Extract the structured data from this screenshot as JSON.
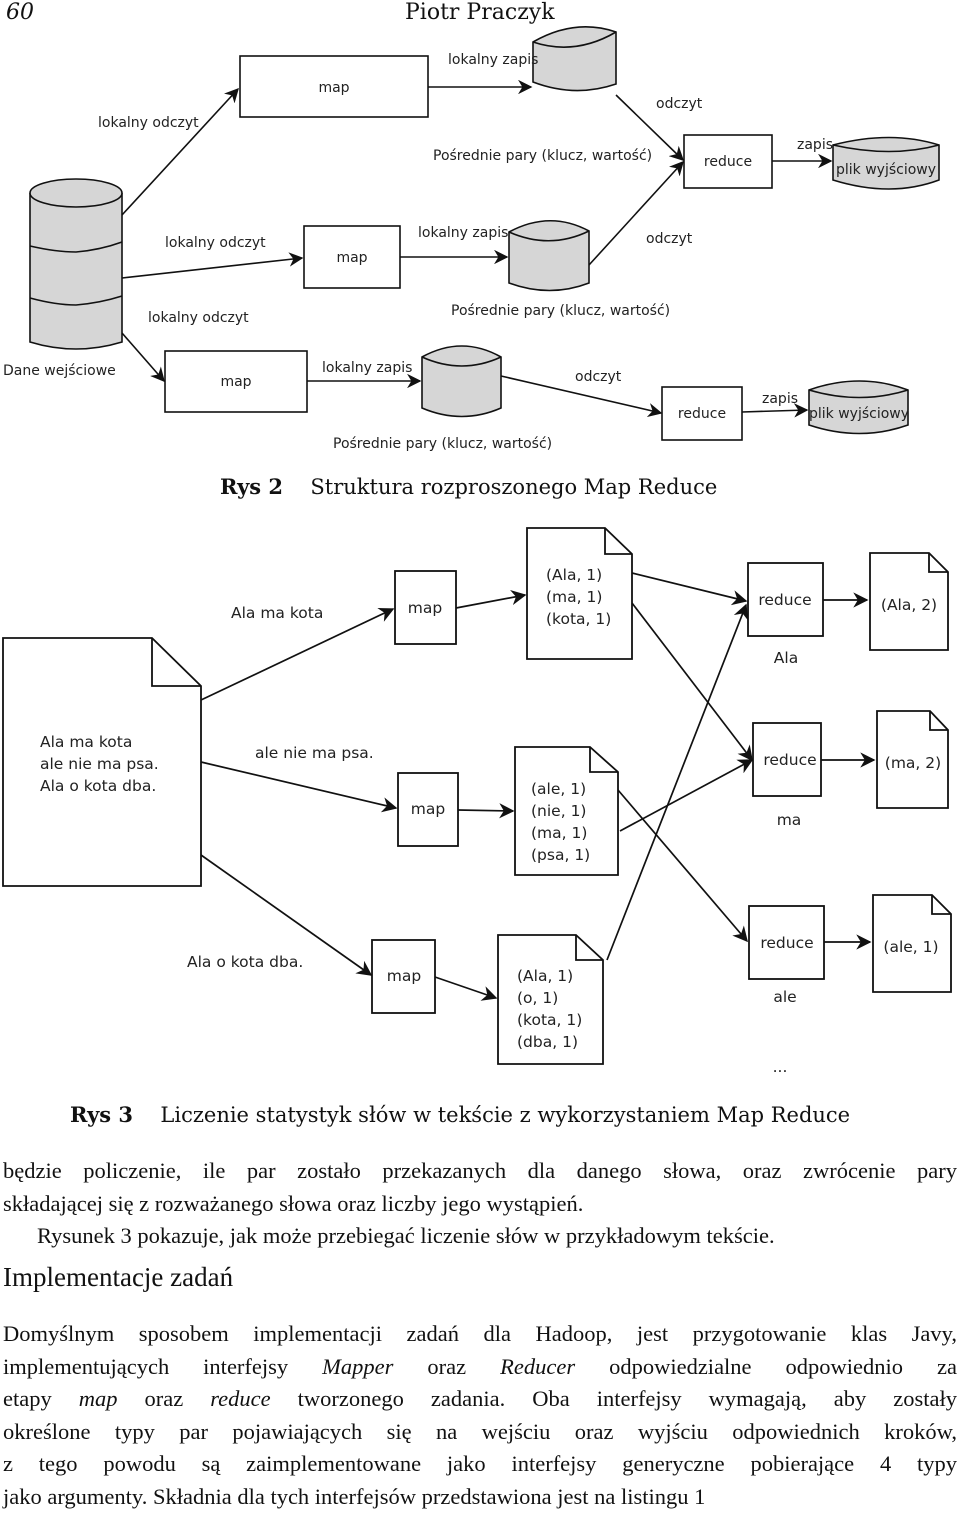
{
  "header": {
    "page_number": "60",
    "running_head": "Piotr Praczyk"
  },
  "figure2": {
    "input_label": "Dane wejściowe",
    "map_label": "map",
    "reduce_label": "reduce",
    "output_label": "plik wyjściowy",
    "local_read": "lokalny odczyt",
    "local_write": "lokalny zapis",
    "read": "odczyt",
    "write": "zapis",
    "intermediate": "Pośrednie pary (klucz, wartość)",
    "caption_num": "Rys 2",
    "caption_text": "Struktura rozproszonego Map Reduce"
  },
  "figure3": {
    "input_doc_lines": [
      "Ala ma kota",
      "ale nie ma psa.",
      "Ala o kota dba."
    ],
    "splits": [
      "Ala ma kota",
      "ale nie ma psa.",
      "Ala o kota dba."
    ],
    "map_label": "map",
    "reduce_label": "reduce",
    "intermediate_docs": [
      [
        "(Ala, 1)",
        "(ma, 1)",
        "(kota, 1)"
      ],
      [
        "(ale, 1)",
        "(nie, 1)",
        "(ma, 1)",
        "(psa, 1)"
      ],
      [
        "(Ala, 1)",
        "(o, 1)",
        "(kota, 1)",
        "(dba, 1)"
      ]
    ],
    "reducer_keys": [
      "Ala",
      "ma",
      "ale"
    ],
    "outputs": [
      "(Ala, 2)",
      "(ma, 2)",
      "(ale, 1)"
    ],
    "ellipsis": "...",
    "caption_num": "Rys 3",
    "caption_text": "Liczenie statystyk słów w tekście z wykorzystaniem Map Reduce"
  },
  "body": {
    "para1_lines": [
      "będzie policzenie, ile par zostało przekazanych dla danego słowa, oraz zwrócenie pary",
      "składającej się z rozważanego słowa oraz liczby jego wystąpień."
    ],
    "para2": "Rysunek 3 pokazuje, jak może przebiegać liczenie słów w przykładowym tekście.",
    "section_title": "Implementacje zadań",
    "para3": {
      "l1": "Domyślnym sposobem implementacji zadań dla Hadoop, jest przygotowanie klas Javy,",
      "l2_a": "implementujących interfejsy ",
      "l2_mapper": "Mapper",
      "l2_b": " oraz ",
      "l2_reducer": "Reducer",
      "l2_c": " odpowiedzialne odpowiednio za",
      "l3_a": "etapy ",
      "l3_map": "map",
      "l3_b": " oraz ",
      "l3_reduce": "reduce",
      "l3_c": " tworzonego zadania. Oba interfejsy wymagają, aby zostały",
      "l4": "określone typy par pojawiających się na wejściu oraz wyjściu odpowiednich kroków,",
      "l5": "z tego powodu są zaimplementowane jako interfejsy generyczne pobierające 4 typy",
      "l6": "jako argumenty. Składnia dla tych interfejsów przedstawiona jest na listingu 1"
    }
  }
}
